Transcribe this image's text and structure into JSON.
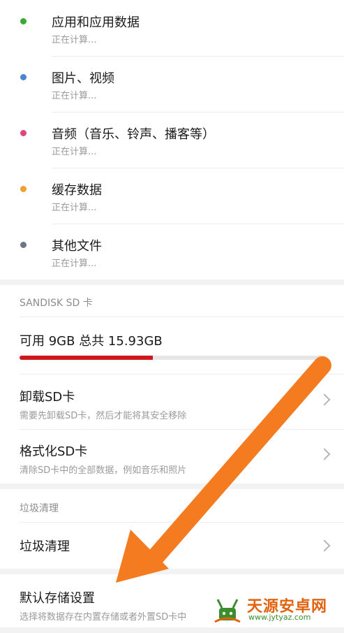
{
  "categories": [
    {
      "title": "应用和应用数据",
      "status": "正在计算...",
      "color": "#3aaa35"
    },
    {
      "title": "图片、视频",
      "status": "正在计算...",
      "color": "#4a86d4"
    },
    {
      "title": "音频（音乐、铃声、播客等）",
      "status": "正在计算...",
      "color": "#e0457b"
    },
    {
      "title": "缓存数据",
      "status": "正在计算...",
      "color": "#f0a030"
    },
    {
      "title": "其他文件",
      "status": "正在计算...",
      "color": "#6b7786"
    }
  ],
  "sd_card": {
    "header": "SANDISK SD 卡",
    "usage_text": "可用 9GB  总共 15.93GB",
    "available_gb": 9,
    "total_gb": 15.93,
    "bar_color": "#d0161c",
    "unmount": {
      "title": "卸载SD卡",
      "subtitle": "需要先卸载SD卡，然后才能将其安全移除"
    },
    "format": {
      "title": "格式化SD卡",
      "subtitle": "清除SD卡中的全部数据，例如音乐和照片"
    }
  },
  "junk": {
    "header": "垃圾清理",
    "item": "垃圾清理"
  },
  "default_storage": {
    "title": "默认存储设置",
    "subtitle": "选择将数据存在内置存储或者外置SD卡中"
  },
  "annotation_color": "#f47b20",
  "watermark": {
    "title": "天源安卓网",
    "url": "www.jytyaz.com"
  }
}
